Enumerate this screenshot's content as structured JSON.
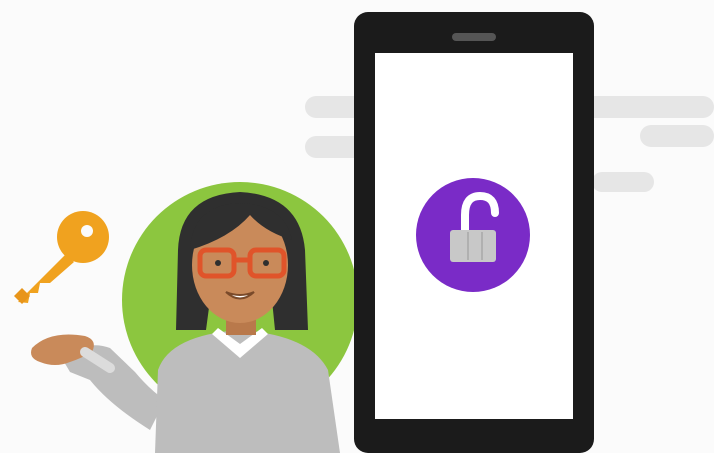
{
  "illustration": {
    "subject": "person-with-key-and-unlocked-phone",
    "icons": [
      "key-icon",
      "unlocked-padlock-icon"
    ],
    "colors": {
      "background": "#fbfbfb",
      "cloud": "#e6e6e6",
      "key": "#f0a21f",
      "circle": "#8cc63f",
      "phone_body": "#1b1b1b",
      "phone_screen": "#ffffff",
      "lock_badge": "#7a2bc7",
      "lock_body": "#c8c8c8",
      "skin": "#c98a5a",
      "hair": "#2f2f2f",
      "glasses": "#e0542a",
      "sweater": "#bdbdbd"
    }
  }
}
